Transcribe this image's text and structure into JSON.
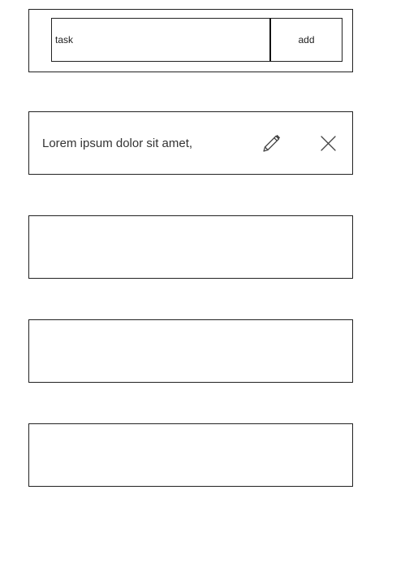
{
  "add_form": {
    "input_placeholder": "task",
    "input_value": "",
    "add_label": "add"
  },
  "tasks": [
    {
      "text": "Lorem ipsum dolor sit amet,"
    },
    {
      "text": ""
    },
    {
      "text": ""
    },
    {
      "text": ""
    }
  ],
  "icons": {
    "edit": "pencil-icon",
    "delete": "close-icon"
  }
}
